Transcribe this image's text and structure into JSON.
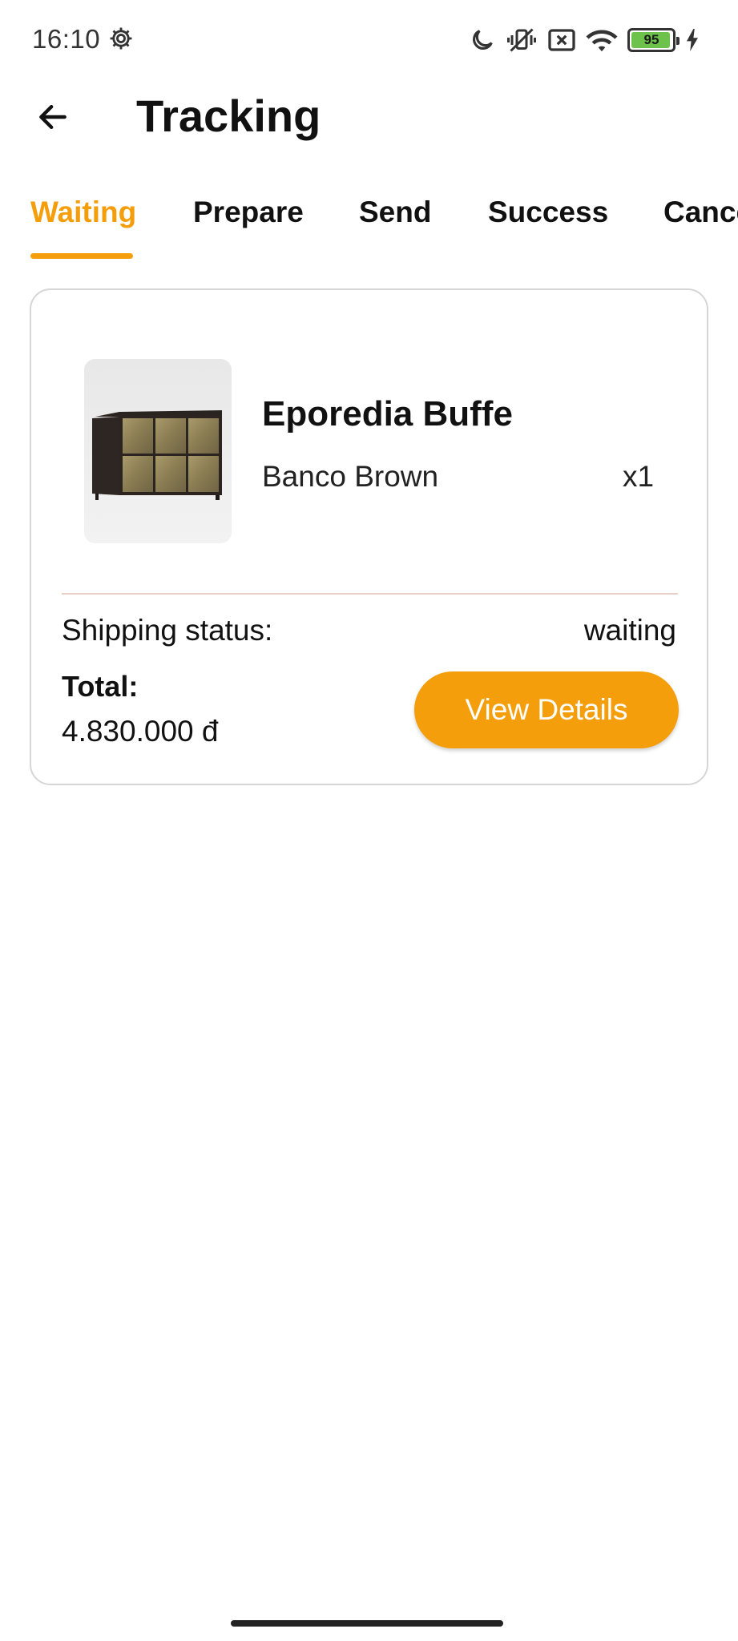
{
  "status_bar": {
    "time": "16:10",
    "battery_percent": "95",
    "icons": [
      "settings-gear-icon",
      "moon-icon",
      "vibrate-off-icon",
      "sim-none-icon",
      "wifi-icon",
      "battery-icon",
      "charging-bolt-icon"
    ]
  },
  "app_bar": {
    "back_icon": "arrow-left-icon",
    "title": "Tracking"
  },
  "tabs": [
    {
      "label": "Waiting",
      "active": true
    },
    {
      "label": "Prepare",
      "active": false
    },
    {
      "label": "Send",
      "active": false
    },
    {
      "label": "Success",
      "active": false
    },
    {
      "label": "Cancel",
      "active": false
    }
  ],
  "order": {
    "product_name": "Eporedia Buffe",
    "variant": "Banco Brown",
    "quantity": "x1",
    "shipping_status_label": "Shipping status:",
    "shipping_status_value": "waiting",
    "total_label": "Total:",
    "total_value": "4.830.000 đ",
    "details_button": "View Details"
  },
  "colors": {
    "accent": "#f59e0b",
    "card_border": "#d6d6d6",
    "divider": "#e7cfc5",
    "battery_fill": "#6cc24a"
  }
}
